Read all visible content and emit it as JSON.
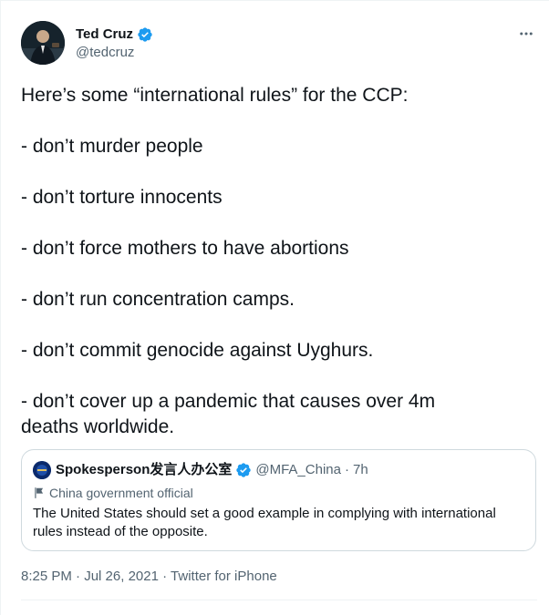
{
  "author": {
    "display_name": "Ted Cruz",
    "handle": "@tedcruz",
    "verified": true,
    "avatar_icon": "profile-photo"
  },
  "more_icon": "more-horizontal-icon",
  "tweet_lines": [
    "Here’s some “international rules” for the CCP:",
    "- don’t murder people",
    "- don’t torture innocents",
    "- don’t force mothers to have abortions",
    "- don’t run concentration camps.",
    "- don’t commit genocide against Uyghurs.",
    "- don’t cover up a pandemic that causes over 4m",
    "deaths worldwide."
  ],
  "quoted": {
    "display_name": "Spokesperson发言人办公室",
    "handle": "@MFA_China",
    "separator": "·",
    "age": "7h",
    "label": "China government official",
    "label_icon": "flag-icon",
    "text": "The United States should set a good example in complying with international rules instead of the opposite."
  },
  "meta": {
    "time": "8:25 PM",
    "separator": "·",
    "date": "Jul 26, 2021",
    "source": "Twitter for iPhone"
  },
  "colors": {
    "verified_blue": "#1d9bf0",
    "secondary_text": "#536471",
    "primary_text": "#0f1419",
    "border": "#cfd9de"
  }
}
